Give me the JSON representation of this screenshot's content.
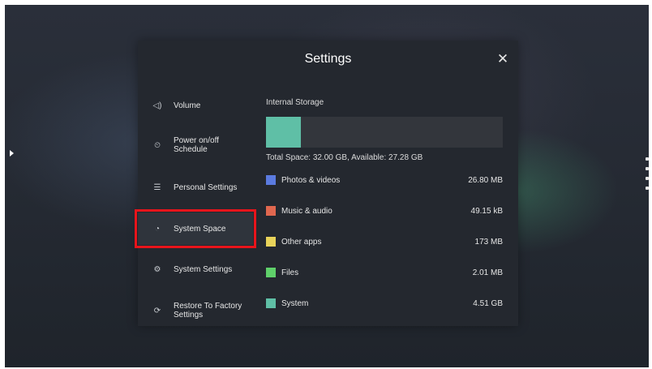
{
  "dialog": {
    "title": "Settings",
    "close_icon": "close-icon"
  },
  "nav": {
    "items": [
      {
        "label": "Volume",
        "icon": "volume-icon",
        "glyph": "◁)"
      },
      {
        "label": "Power on/off Schedule",
        "icon": "clock-icon",
        "glyph": "⏲"
      },
      {
        "label": "Personal Settings",
        "icon": "sliders-icon",
        "glyph": "☰"
      },
      {
        "label": "System Space",
        "icon": "pie-chart-icon",
        "glyph": "◔",
        "active": true
      },
      {
        "label": "System Settings",
        "icon": "gear-icon",
        "glyph": "⚙"
      },
      {
        "label": "Restore To Factory Settings",
        "icon": "restore-icon",
        "glyph": "⟳"
      }
    ]
  },
  "storage": {
    "title": "Internal Storage",
    "total_text": "Total Space: 32.00 GB, Available: 27.28 GB",
    "used_fraction": 0.1475,
    "categories": [
      {
        "label": "Photos & videos",
        "size": "26.80 MB",
        "color": "#5b7be0"
      },
      {
        "label": "Music & audio",
        "size": "49.15 kB",
        "color": "#e0674f"
      },
      {
        "label": "Other apps",
        "size": "173 MB",
        "color": "#e8d35a"
      },
      {
        "label": "Files",
        "size": "2.01 MB",
        "color": "#5fd06a"
      },
      {
        "label": "System",
        "size": "4.51 GB",
        "color": "#5fbfa6"
      }
    ]
  },
  "colors": {
    "highlight": "#e8141b",
    "dialog_bg": "#24282f"
  }
}
